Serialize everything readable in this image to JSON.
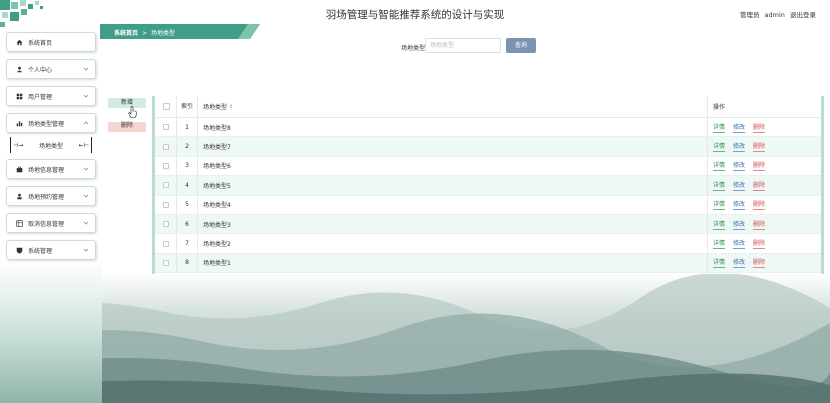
{
  "header": {
    "title": "羽场管理与智能推荐系统的设计与实现",
    "role": "管理员",
    "username": "admin",
    "logout": "退出登录"
  },
  "breadcrumb": {
    "home": "系统首页",
    "separator": ">",
    "current": "场地类型"
  },
  "sidebar": {
    "items": [
      {
        "label": "系统首页",
        "icon": "home-icon",
        "expandable": false
      },
      {
        "label": "个人中心",
        "icon": "user-icon",
        "expandable": true
      },
      {
        "label": "用户管理",
        "icon": "grid-icon",
        "expandable": true
      },
      {
        "label": "场地类型管理",
        "icon": "bar-chart-icon",
        "expandable": true,
        "expanded": true
      },
      {
        "label": "场地信息管理",
        "icon": "briefcase-icon",
        "expandable": true
      },
      {
        "label": "场地预约管理",
        "icon": "person-icon",
        "expandable": true
      },
      {
        "label": "取消信息管理",
        "icon": "table-icon",
        "expandable": true
      },
      {
        "label": "系统管理",
        "icon": "shield-icon",
        "expandable": true
      }
    ],
    "sub_item": "场地类型"
  },
  "search": {
    "label": "场地类型",
    "placeholder": "场地类型",
    "button": "查询"
  },
  "actions": {
    "add": "新增",
    "delete": "删除"
  },
  "table": {
    "headers": {
      "index": "索引",
      "type": "场地类型",
      "ops": "操作"
    },
    "op_labels": {
      "detail": "详情",
      "edit": "修改",
      "remove": "删除"
    },
    "rows": [
      {
        "index": "1",
        "type": "场地类型8"
      },
      {
        "index": "2",
        "type": "场地类型7"
      },
      {
        "index": "3",
        "type": "场地类型6"
      },
      {
        "index": "4",
        "type": "场地类型5"
      },
      {
        "index": "5",
        "type": "场地类型4"
      },
      {
        "index": "6",
        "type": "场地类型3"
      },
      {
        "index": "7",
        "type": "场地类型2"
      },
      {
        "index": "8",
        "type": "场地类型1"
      }
    ]
  },
  "colors": {
    "accent": "#3f9e86",
    "table_border": "#b8ddd0",
    "row_alt": "#eef8f4",
    "search_button": "#7b94b3",
    "add_button": "#d4ebe3",
    "delete_button": "#f6d4cf"
  }
}
